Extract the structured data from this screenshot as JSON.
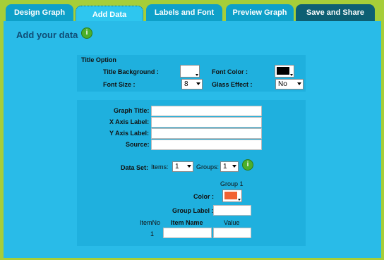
{
  "tabs": [
    {
      "label": "Design Graph"
    },
    {
      "label": "Add Data"
    },
    {
      "label": "Labels and Font"
    },
    {
      "label": "Preview Graph"
    },
    {
      "label": "Save and Share"
    }
  ],
  "heading": "Add your data",
  "title_option": {
    "section_label": "Title Option",
    "title_background_label": "Title Background :",
    "title_background_color": "#ffffff",
    "font_color_label": "Font Color :",
    "font_color": "#000000",
    "font_size_label": "Font Size :",
    "font_size_value": "8",
    "glass_effect_label": "Glass Effect :",
    "glass_effect_value": "No"
  },
  "labels": {
    "graph_title": "Graph Title:",
    "x_axis_label": "X Axis Label:",
    "y_axis_label": "Y Axis Label:",
    "source": "Source:"
  },
  "data_set": {
    "label": "Data Set:",
    "items_label": "Items:",
    "items_value": "1",
    "groups_label": "Groups:",
    "groups_value": "1"
  },
  "group": {
    "header": "Group 1",
    "color_label": "Color :",
    "color": "#f26232",
    "group_label_label": "Group Label :"
  },
  "table": {
    "item_no_header": "ItemNo",
    "item_name_header": "Item Name",
    "value_header": "Value",
    "rows": [
      {
        "item_no": "1"
      }
    ]
  }
}
